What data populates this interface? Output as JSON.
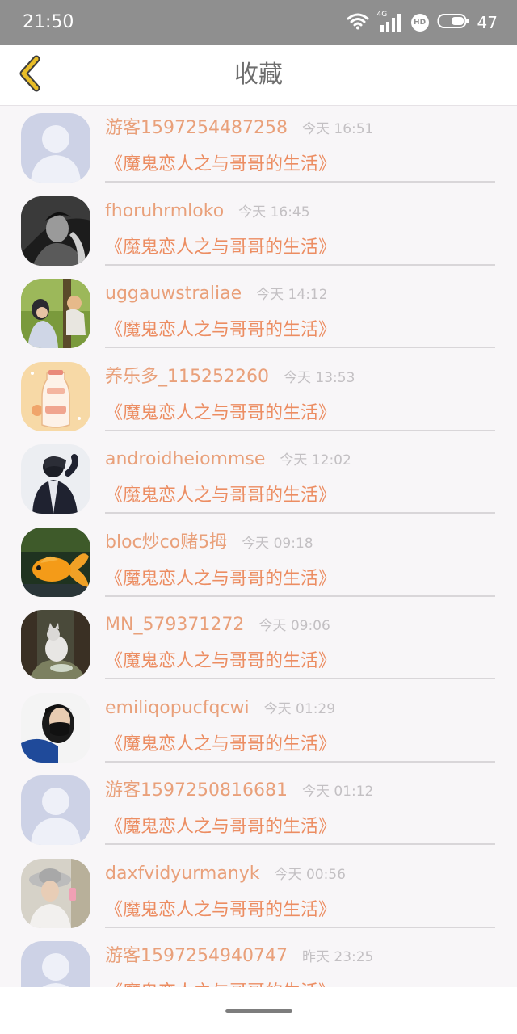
{
  "status_bar": {
    "time": "21:50",
    "network": "4G",
    "hd": "HD",
    "battery": "47",
    "icons": [
      "wifi-icon",
      "signal-icon",
      "hd-icon",
      "battery-icon"
    ]
  },
  "header": {
    "title": "收藏",
    "back_icon": "chevron-left-icon",
    "accent_color": "#e8bd28"
  },
  "items": [
    {
      "name": "游客1597254487258",
      "time": "今天 16:51",
      "title": "《魔鬼恋人之与哥哥的生活》",
      "avatar": "default-avatar"
    },
    {
      "name": "fhoruhrmloko",
      "time": "今天 16:45",
      "title": "《魔鬼恋人之与哥哥的生活》",
      "avatar": "photo-avatar-bw-person"
    },
    {
      "name": "uggauwstraliae",
      "time": "今天 14:12",
      "title": "《魔鬼恋人之与哥哥的生活》",
      "avatar": "photo-avatar-forest-girl"
    },
    {
      "name": "养乐多_115252260",
      "time": "今天 13:53",
      "title": "《魔鬼恋人之与哥哥的生活》",
      "avatar": "photo-avatar-yakult"
    },
    {
      "name": "androidheiommse",
      "time": "今天 12:02",
      "title": "《魔鬼恋人之与哥哥的生活》",
      "avatar": "photo-avatar-dark-jacket"
    },
    {
      "name": "bloc炒co赌5拇",
      "time": "今天 09:18",
      "title": "《魔鬼恋人之与哥哥的生活》",
      "avatar": "photo-avatar-goldfish"
    },
    {
      "name": "MN_579371272",
      "time": "今天 09:06",
      "title": "《魔鬼恋人之与哥哥的生活》",
      "avatar": "photo-avatar-cat"
    },
    {
      "name": "emiliqopucfqcwi",
      "time": "今天 01:29",
      "title": "《魔鬼恋人之与哥哥的生活》",
      "avatar": "photo-avatar-masked-girl"
    },
    {
      "name": "游客1597250816681",
      "time": "今天 01:12",
      "title": "《魔鬼恋人之与哥哥的生活》",
      "avatar": "default-avatar"
    },
    {
      "name": "daxfvidyurmanyk",
      "time": "今天 00:56",
      "title": "《魔鬼恋人之与哥哥的生活》",
      "avatar": "photo-avatar-hat-girl"
    },
    {
      "name": "游客1597254940747",
      "time": "昨天 23:25",
      "title": "《魔鬼恋人之与哥哥的生活》",
      "avatar": "default-avatar"
    }
  ]
}
